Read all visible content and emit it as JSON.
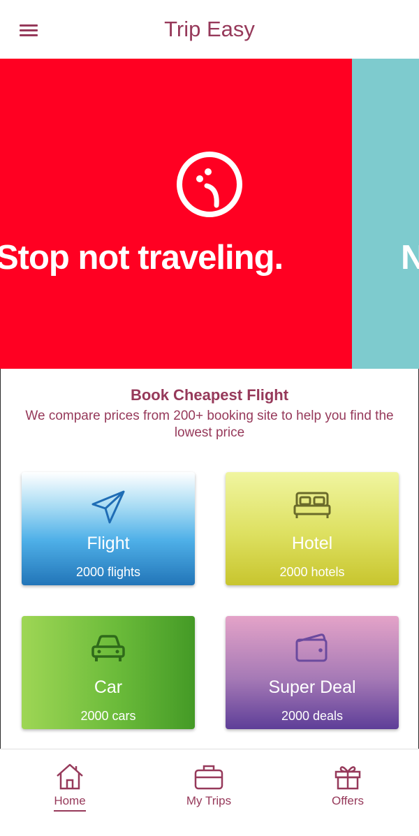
{
  "header": {
    "title": "Trip Easy",
    "menu_icon": "hamburger-menu-icon"
  },
  "banner": {
    "slides": [
      {
        "text": "Stop not traveling.",
        "background": "#ff0022",
        "icon": "sad-face-icon"
      },
      {
        "text": "N",
        "background": "#7ecbce"
      }
    ]
  },
  "intro": {
    "title": "Book Cheapest Flight",
    "subtitle": "We compare prices from 200+ booking site to help you find the lowest price"
  },
  "cards": [
    {
      "label": "Flight",
      "count": "2000 flights",
      "icon": "paper-plane-icon"
    },
    {
      "label": "Hotel",
      "count": "2000 hotels",
      "icon": "bed-icon"
    },
    {
      "label": "Car",
      "count": "2000 cars",
      "icon": "car-icon"
    },
    {
      "label": "Super Deal",
      "count": "2000 deals",
      "icon": "wallet-icon"
    }
  ],
  "bottom_nav": {
    "items": [
      {
        "label": "Home",
        "icon": "home-icon",
        "active": true
      },
      {
        "label": "My Trips",
        "icon": "briefcase-icon",
        "active": false
      },
      {
        "label": "Offers",
        "icon": "gift-icon",
        "active": false
      }
    ]
  },
  "colors": {
    "accent": "#96395a",
    "banner_red": "#ff0022",
    "banner_teal": "#7ecbce"
  }
}
